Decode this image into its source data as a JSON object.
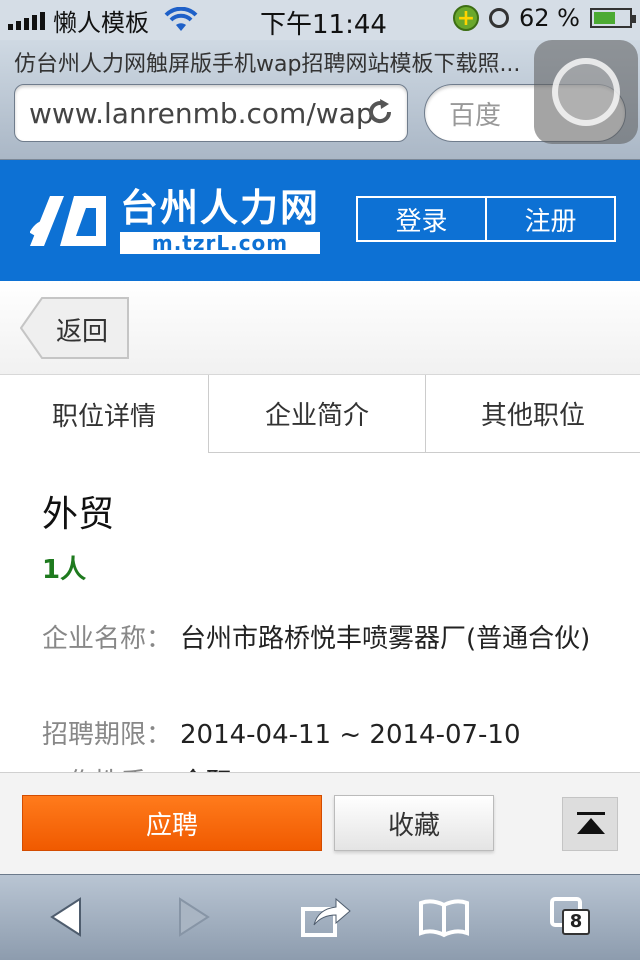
{
  "status_bar": {
    "carrier": "懒人模板",
    "time": "下午11:44",
    "battery_pct": "62 %",
    "battery_level": 0.62
  },
  "browser": {
    "page_title": "仿台州人力网触屏版手机wap招聘网站模板下载照...",
    "url": "www.lanrenmb.com/wap",
    "search_placeholder": "百度"
  },
  "header": {
    "logo_cn": "台州人力网",
    "logo_url": "m.tzrL.com",
    "login_label": "登录",
    "register_label": "注册",
    "bg_color": "#0d71d4"
  },
  "nav": {
    "back_label": "返回"
  },
  "tabs": [
    {
      "label": "职位详情",
      "active": true
    },
    {
      "label": "企业简介",
      "active": false
    },
    {
      "label": "其他职位",
      "active": false
    }
  ],
  "job": {
    "title": "外贸",
    "headcount": "1人",
    "fields": [
      {
        "label": "企业名称：",
        "value": "台州市路桥悦丰喷雾器厂(普通合伙)"
      },
      {
        "label": "招聘期限：",
        "value": "2014-04-11 ~ 2014-07-10"
      },
      {
        "label": "工作性质：",
        "value": "全职"
      }
    ]
  },
  "actions": {
    "apply_label": "应聘",
    "favorite_label": "收藏",
    "apply_color": "#f26a0c"
  },
  "toolbar": {
    "tab_count": "8",
    "icons": [
      "back-arrow-icon",
      "forward-arrow-icon",
      "share-icon",
      "bookmarks-icon",
      "tabs-icon"
    ]
  }
}
